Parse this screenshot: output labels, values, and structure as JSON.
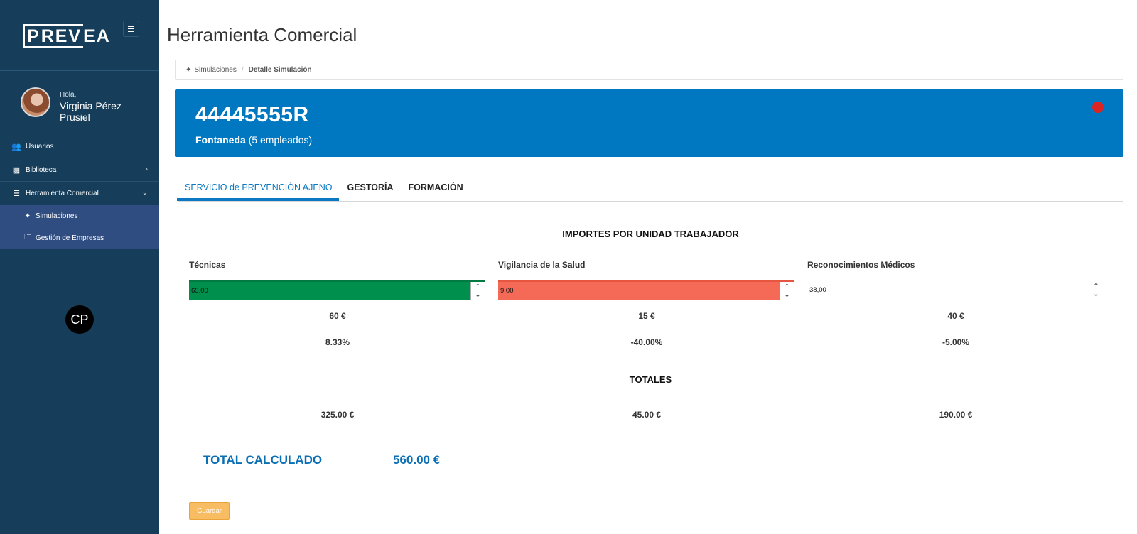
{
  "sidebar": {
    "logo": {
      "p": "P",
      "rest": "REV",
      "end": "EA"
    },
    "greeting": "Hola,",
    "user_name": "Virginia Pérez Prusiel",
    "items": [
      {
        "label": "Usuarios",
        "icon": "users-icon"
      },
      {
        "label": "Biblioteca",
        "icon": "archive-icon"
      },
      {
        "label": "Herramienta Comercial",
        "icon": "list-icon"
      }
    ],
    "subitems": [
      {
        "label": "Simulaciones",
        "icon": "magic-wand-icon"
      },
      {
        "label": "Gestión de Empresas",
        "icon": "folder-icon"
      }
    ],
    "badge_initials": "CP"
  },
  "header": {
    "title": "Herramienta Comercial"
  },
  "breadcrumb": {
    "parent": "Simulaciones",
    "separator": "/",
    "current": "Detalle Simulación"
  },
  "banner": {
    "cif": "44445555R",
    "company_name": "Fontaneda",
    "employees": "(5 empleados)",
    "status_color": "#dd2424",
    "background_color": "#0078c1"
  },
  "tabs": [
    {
      "label": "SERVICIO de PREVENCIÓN AJENO",
      "active": true
    },
    {
      "label": "GESTORÍA",
      "active": false
    },
    {
      "label": "FORMACIÓN",
      "active": false
    }
  ],
  "main": {
    "section_title": "IMPORTES POR UNIDAD TRABAJADOR",
    "columns": [
      {
        "label": "Técnicas",
        "input_value": "65,00",
        "state_color": "#008f4c",
        "price": "60 €",
        "percent": "8.33%",
        "total": "325.00 €"
      },
      {
        "label": "Vigilancia de la Salud",
        "input_value": "9,00",
        "state_color": "#f46a57",
        "price": "15 €",
        "percent": "-40.00%",
        "total": "45.00 €"
      },
      {
        "label": "Reconocimientos Médicos",
        "input_value": "38,00",
        "state_color": "#ffffff",
        "price": "40 €",
        "percent": "-5.00%",
        "total": "190.00 €"
      }
    ],
    "totals_title": "TOTALES",
    "total_label": "TOTAL CALCULADO",
    "total_value": "560.00 €",
    "save_label": "Guardar"
  }
}
